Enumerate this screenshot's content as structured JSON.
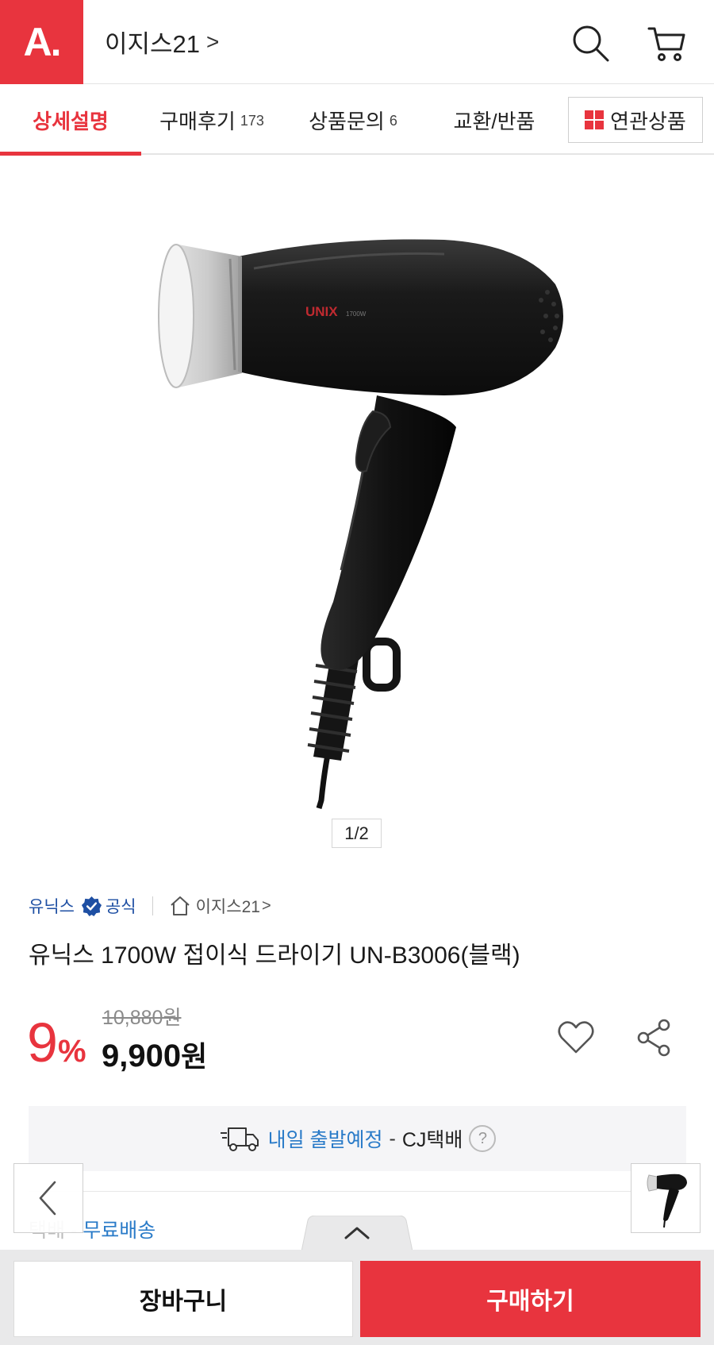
{
  "header": {
    "logo_text": "A.",
    "store_name": "이지스21",
    "store_chevron": ">",
    "search_icon": "search-icon",
    "cart_icon": "cart-icon"
  },
  "tabs": [
    {
      "label": "상세설명",
      "count": "",
      "active": true
    },
    {
      "label": "구매후기",
      "count": "173",
      "active": false
    },
    {
      "label": "상품문의",
      "count": "6",
      "active": false
    },
    {
      "label": "교환/반품",
      "count": "",
      "active": false
    }
  ],
  "related_tab": {
    "label": "연관상품"
  },
  "gallery": {
    "pager": "1/2",
    "brand_mark": "UNIX"
  },
  "product": {
    "brand": "유닉스",
    "official": "공식",
    "seller": "이지스21",
    "seller_chevron": ">",
    "title": "유닉스 1700W 접이식 드라이기 UN-B3006(블랙)",
    "discount_value": "9",
    "discount_unit": "%",
    "original_price": "10,880원",
    "price": "9,900",
    "price_unit": "원"
  },
  "shipping": {
    "date": "내일 출발예정",
    "dash": "-",
    "carrier": "CJ택배",
    "help": "?",
    "fee_label": "택배",
    "fee_dash": "-",
    "fee_value": "무료배송"
  },
  "actions": {
    "cart_label": "장바구니",
    "buy_label": "구매하기"
  },
  "colors": {
    "accent": "#e8343e",
    "link_blue": "#2a7bc8",
    "brand_blue": "#1e4fa3"
  }
}
